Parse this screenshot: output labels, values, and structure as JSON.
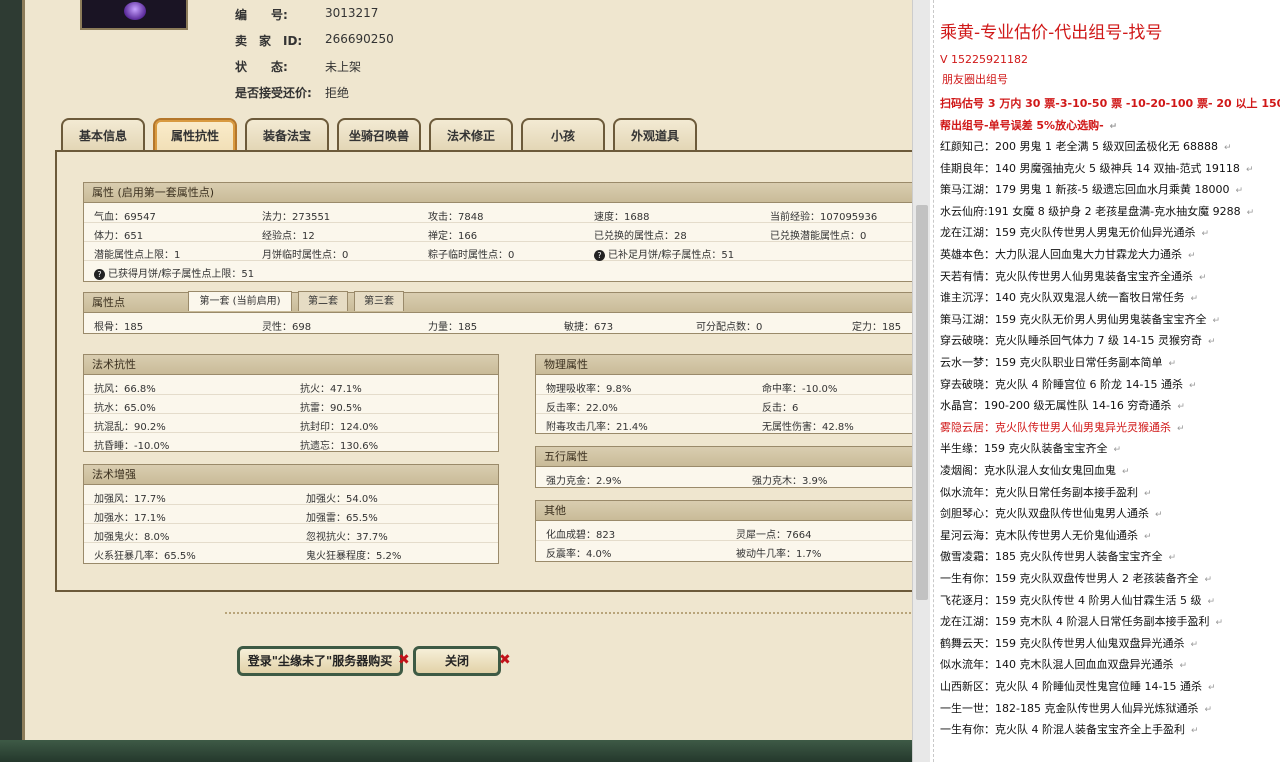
{
  "info": [
    {
      "key": "编　　号:",
      "value": "3013217"
    },
    {
      "key": "卖　家　ID:",
      "value": "266690250"
    },
    {
      "key": "状　　态:",
      "value": "未上架"
    },
    {
      "key": "是否接受还价:",
      "value": "拒绝"
    }
  ],
  "tabs": [
    "基本信息",
    "属性抗性",
    "装备法宝",
    "坐骑召唤兽",
    "法术修正",
    "小孩",
    "外观道具"
  ],
  "attr": {
    "title": "属性 (启用第一套属性点)",
    "rows": [
      [
        "气血：69547",
        "法力：273551",
        "攻击：7848",
        "速度：1688",
        "当前经验：107095936"
      ],
      [
        "体力：651",
        "经验点：12",
        "禅定：166",
        "已兑换的属性点：28",
        "已兑换潜能属性点：0"
      ],
      [
        "潜能属性点上限：1",
        "月饼临时属性点：0",
        "粽子临时属性点：0",
        "已补足月饼/粽子属性点：51",
        ""
      ],
      [
        "已获得月饼/粽子属性点上限：51",
        "",
        "",
        "",
        ""
      ]
    ]
  },
  "points": {
    "title": "属性点",
    "subtabs": [
      "第一套 (当前启用)",
      "第二套",
      "第三套"
    ],
    "values": [
      "根骨：185",
      "灵性：698",
      "力量：185",
      "敏捷：673",
      "可分配点数：0",
      "定力：185"
    ]
  },
  "resist": {
    "title": "法术抗性",
    "rows": [
      [
        "抗风：66.8%",
        "抗火：47.1%"
      ],
      [
        "抗水：65.0%",
        "抗雷：90.5%"
      ],
      [
        "抗混乱：90.2%",
        "抗封印：124.0%"
      ],
      [
        "抗昏睡：-10.0%",
        "抗遗忘：130.6%"
      ]
    ]
  },
  "enhance": {
    "title": "法术增强",
    "rows": [
      [
        "加强风：17.7%",
        "加强火：54.0%"
      ],
      [
        "加强水：17.1%",
        "加强雷：65.5%"
      ],
      [
        "加强鬼火：8.0%",
        "忽视抗火：37.7%"
      ],
      [
        "火系狂暴几率：65.5%",
        "鬼火狂暴程度：5.2%"
      ]
    ]
  },
  "physical": {
    "title": "物理属性",
    "rows": [
      [
        "物理吸收率：9.8%",
        "命中率：-10.0%"
      ],
      [
        "反击率：22.0%",
        "反击：6"
      ],
      [
        "附毒攻击几率：21.4%",
        "无属性伤害：42.8%"
      ]
    ]
  },
  "five": {
    "title": "五行属性",
    "rows": [
      [
        "强力克金：2.9%",
        "强力克木：3.9%"
      ]
    ]
  },
  "other": {
    "title": "其他",
    "rows": [
      [
        "化血成碧：823",
        "灵犀一点：7664"
      ],
      [
        "反震率：4.0%",
        "被动牛几率：1.7%"
      ]
    ]
  },
  "buttons": {
    "buy": "登录\"尘缘未了\"服务器购买",
    "close": "关闭",
    "x": "✖"
  },
  "right": {
    "lines": [
      {
        "t": "乘黄-专业估价-代出组号-找号",
        "s": "hdr"
      },
      {
        "t": "V 15225921182",
        "s": "red"
      },
      {
        "t": "朋友圈出组号",
        "s": "red"
      },
      {
        "t": "扫码估号 3 万内 30 票-3-10-50 票 -10-20-100 票- 20 以上 150",
        "s": "red bold"
      },
      {
        "t": "帮出组号-单号误差 5%放心选购-",
        "s": "red bold"
      },
      {
        "t": "红颜知己：200 男鬼 1 老全满 5 级双回孟极化无 68888",
        "s": ""
      },
      {
        "t": "佳期良年：140 男魔强抽克火 5 级神兵 14 双抽-范式 19118",
        "s": ""
      },
      {
        "t": "策马江湖：179 男鬼 1 新孩-5 级遗忘回血水月乘黄 18000",
        "s": ""
      },
      {
        "t": "水云仙府:191 女魔 8 级护身 2 老孩星盘满-克水抽女魔 9288",
        "s": ""
      },
      {
        "t": "龙在江湖：159 克火队传世男人男鬼无价仙异光通杀",
        "s": ""
      },
      {
        "t": "英雄本色：大力队混人回血鬼大力甘霖龙大力通杀",
        "s": ""
      },
      {
        "t": "天若有情：克火队传世男人仙男鬼装备宝宝齐全通杀",
        "s": ""
      },
      {
        "t": "谁主沉浮：140 克火队双鬼混人统一畜牧日常任务",
        "s": ""
      },
      {
        "t": "策马江湖：159 克火队无价男人男仙男鬼装备宝宝齐全",
        "s": ""
      },
      {
        "t": "穿云破晓：克火队睡杀回气体力 7 级 14-15 灵猴穷奇",
        "s": ""
      },
      {
        "t": "云水一梦：159 克火队职业日常任务副本简单",
        "s": ""
      },
      {
        "t": "穿去破晓：克火队 4 阶睡宫位 6 阶龙 14-15 通杀",
        "s": ""
      },
      {
        "t": "水晶宫：190-200 级无属性队 14-16 穷奇通杀",
        "s": ""
      },
      {
        "t": "雾隐云居：克火队传世男人仙男鬼异光灵猴通杀",
        "s": "red"
      },
      {
        "t": "半生缘：159 克火队装备宝宝齐全",
        "s": ""
      },
      {
        "t": "凌烟阁：克水队混人女仙女鬼回血鬼",
        "s": ""
      },
      {
        "t": "似水流年：克火队日常任务副本接手盈利",
        "s": ""
      },
      {
        "t": "剑胆琴心：克火队双盘队传世仙鬼男人通杀",
        "s": ""
      },
      {
        "t": "星河云海：克木队传世男人无价鬼仙通杀",
        "s": ""
      },
      {
        "t": "傲雪凌霜：185 克火队传世男人装备宝宝齐全",
        "s": ""
      },
      {
        "t": "一生有你：159 克火队双盘传世男人 2 老孩装备齐全",
        "s": ""
      },
      {
        "t": "飞花逐月：159 克火队传世 4 阶男人仙甘霖生活 5 级",
        "s": ""
      },
      {
        "t": "龙在江湖：159 克木队 4 阶混人日常任务副本接手盈利",
        "s": ""
      },
      {
        "t": "鹤舞云天：159 克火队传世男人仙鬼双盘异光通杀",
        "s": ""
      },
      {
        "t": "似水流年：140 克木队混人回血血双盘异光通杀",
        "s": ""
      },
      {
        "t": "山西新区：克火队 4 阶睡仙灵性鬼宫位睡 14-15 通杀",
        "s": ""
      },
      {
        "t": "一生一世：182-185 克金队传世男人仙异光炼狱通杀",
        "s": ""
      },
      {
        "t": "一生有你：克火队 4 阶混人装备宝宝齐全上手盈利",
        "s": ""
      }
    ]
  }
}
